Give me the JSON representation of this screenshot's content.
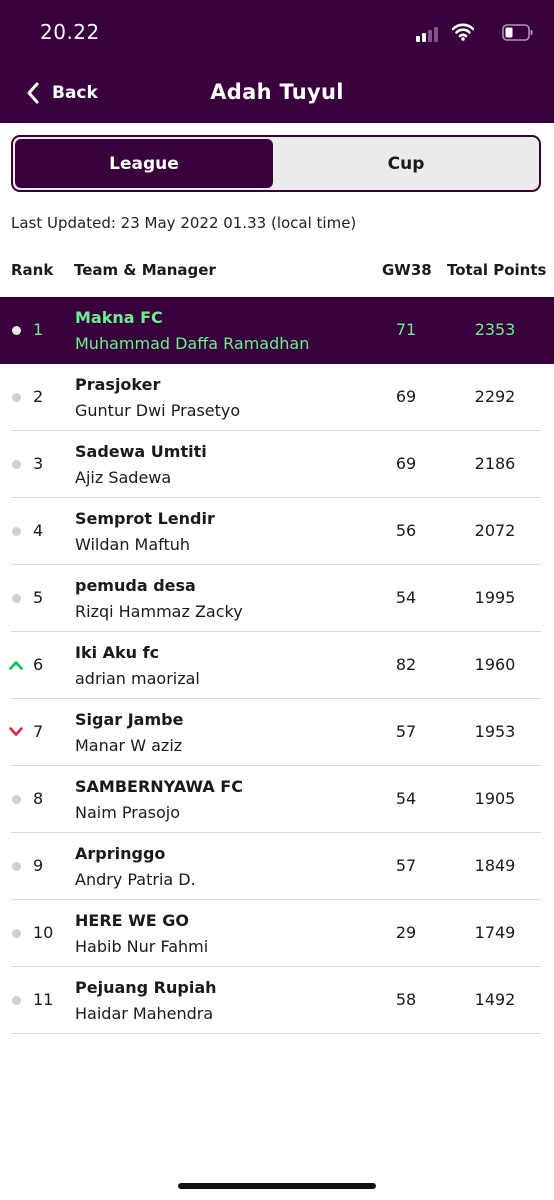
{
  "status_bar": {
    "time": "20.22"
  },
  "header": {
    "back_label": "Back",
    "title": "Adah Tuyul"
  },
  "tabs": [
    {
      "label": "League",
      "active": true
    },
    {
      "label": "Cup",
      "active": false
    }
  ],
  "last_updated": "Last Updated: 23 May 2022 01.33 (local time)",
  "columns": {
    "rank": "Rank",
    "team_manager": "Team & Manager",
    "gw": "GW38",
    "total": "Total Points"
  },
  "colors": {
    "brand": "#38003c",
    "highlight_text": "#6bf08c",
    "up": "#00c853",
    "down": "#e0253a"
  },
  "rows": [
    {
      "rank": "1",
      "team": "Makna FC",
      "manager": "Muhammad Daffa Ramadhan",
      "gw": "71",
      "total": "2353",
      "movement": "same",
      "highlight": true
    },
    {
      "rank": "2",
      "team": "Prasjoker",
      "manager": "Guntur Dwi Prasetyo",
      "gw": "69",
      "total": "2292",
      "movement": "same"
    },
    {
      "rank": "3",
      "team": "Sadewa Umtiti",
      "manager": "Ajiz Sadewa",
      "gw": "69",
      "total": "2186",
      "movement": "same"
    },
    {
      "rank": "4",
      "team": "Semprot Lendir",
      "manager": "Wildan Maftuh",
      "gw": "56",
      "total": "2072",
      "movement": "same"
    },
    {
      "rank": "5",
      "team": "pemuda desa",
      "manager": "Rizqi Hammaz Zacky",
      "gw": "54",
      "total": "1995",
      "movement": "same"
    },
    {
      "rank": "6",
      "team": "Iki Aku fc",
      "manager": "adrian maorizal",
      "gw": "82",
      "total": "1960",
      "movement": "up"
    },
    {
      "rank": "7",
      "team": "Sigar Jambe",
      "manager": "Manar W aziz",
      "gw": "57",
      "total": "1953",
      "movement": "down"
    },
    {
      "rank": "8",
      "team": "SAMBERNYAWA FC",
      "manager": "Naim Prasojo",
      "gw": "54",
      "total": "1905",
      "movement": "same"
    },
    {
      "rank": "9",
      "team": "Arpringgo",
      "manager": "Andry Patria D.",
      "gw": "57",
      "total": "1849",
      "movement": "same"
    },
    {
      "rank": "10",
      "team": "HERE WE GO",
      "manager": "Habib Nur Fahmi",
      "gw": "29",
      "total": "1749",
      "movement": "same"
    },
    {
      "rank": "11",
      "team": "Pejuang Rupiah",
      "manager": "Haidar Mahendra",
      "gw": "58",
      "total": "1492",
      "movement": "same"
    }
  ]
}
